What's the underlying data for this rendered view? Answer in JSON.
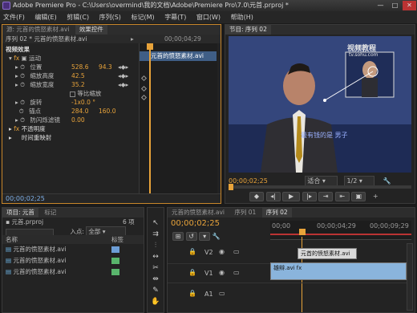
{
  "app": {
    "title": "Adobe Premiere Pro - C:\\Users\\overmind\\我的文档\\Adobe\\Premiere Pro\\7.0\\元首.prproj *"
  },
  "menu": [
    "文件(F)",
    "编辑(E)",
    "剪辑(C)",
    "序列(S)",
    "标记(M)",
    "字幕(T)",
    "窗口(W)",
    "帮助(H)"
  ],
  "source_panel": {
    "tabs": [
      "源: 元首的愤怒素材.avi",
      "效果控件"
    ],
    "sequence_clip": "序列 02 * 元首的愤怒素材.avi",
    "timecode_ruler": "00;00;04;29",
    "clip_label": "元首的愤怒素材.avi",
    "video_effects": "视频效果",
    "motion": "运动",
    "properties": [
      {
        "name": "位置",
        "v1": "528.6",
        "v2": "94.3"
      },
      {
        "name": "缩放高度",
        "v1": "42.5",
        "v2": ""
      },
      {
        "name": "缩放宽度",
        "v1": "35.2",
        "v2": ""
      },
      {
        "name": "等比缩放",
        "v1": "",
        "v2": ""
      },
      {
        "name": "旋转",
        "v1": "-1x0.0 °",
        "v2": ""
      },
      {
        "name": "锚点",
        "v1": "284.0",
        "v2": "160.0"
      },
      {
        "name": "防闪烁滤镜",
        "v1": "0.00",
        "v2": ""
      }
    ],
    "opacity": "不透明度",
    "time_remap": "时间重映射",
    "current_time": "00;00;02;25"
  },
  "program_panel": {
    "tab": "节目: 序列 02",
    "watermark": "视频教程",
    "watermark_url": "tv.sohu.com",
    "subtitle": "最有钱的是 男子",
    "timecode": "00;00;02;25",
    "fit": "适合",
    "quality": "1/2"
  },
  "project_panel": {
    "tabs": [
      "项目: 元首",
      "标记"
    ],
    "count": "6 项",
    "project_name": "元首.prproj",
    "in_label": "入点:",
    "in_value": "全部",
    "columns": [
      "名称",
      "标签"
    ],
    "items": [
      "元首的愤怒素材.avi",
      "元首的愤怒素材.avi",
      "元首的愤怒素材.avi"
    ]
  },
  "timeline_panel": {
    "tabs": [
      "元首的愤怒素材.avi",
      "序列 01",
      "序列 02"
    ],
    "timecode": "00;00;02;25",
    "ruler": [
      "00;00",
      "00;00;04;29",
      "00;00;09;29"
    ],
    "tracks": [
      {
        "name": "V2",
        "clip": "元首的愤怒素材.avi"
      },
      {
        "name": "V1",
        "clip": "雄辩.avi"
      },
      {
        "name": "A1",
        "clip": ""
      }
    ]
  },
  "colors": {
    "accent": "#e8a33a",
    "clip_v1": "#8ab4dc",
    "clip_v2": "#d9d9d9",
    "playhead": "#e8a33a"
  }
}
